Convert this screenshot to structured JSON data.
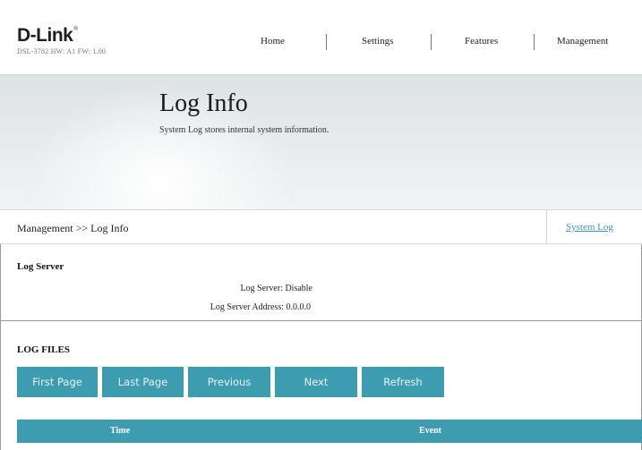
{
  "header": {
    "logo_text": "D-Link",
    "logo_reg": "®",
    "model_info": "DSL-3782  HW: A1  FW: 1.00",
    "nav": [
      {
        "label": "Home"
      },
      {
        "label": "Settings"
      },
      {
        "label": "Features"
      },
      {
        "label": "Management"
      }
    ]
  },
  "banner": {
    "title": "Log Info",
    "subtitle": "System Log stores internal system information."
  },
  "breadcrumb": {
    "path": "Management >> Log Info",
    "tab_label": "System Log"
  },
  "log_server": {
    "section_title": "Log Server",
    "status_text": "Log Server: Disable",
    "address_text": "Log Server Address: 0.0.0.0"
  },
  "log_files": {
    "section_title": "LOG FILES",
    "buttons": [
      {
        "label": "First Page"
      },
      {
        "label": "Last Page"
      },
      {
        "label": "Previous"
      },
      {
        "label": "Next"
      },
      {
        "label": "Refresh"
      }
    ],
    "columns": [
      "Time",
      "Event"
    ]
  },
  "colors": {
    "accent": "#3d9cb0",
    "link": "#3a96b5"
  }
}
